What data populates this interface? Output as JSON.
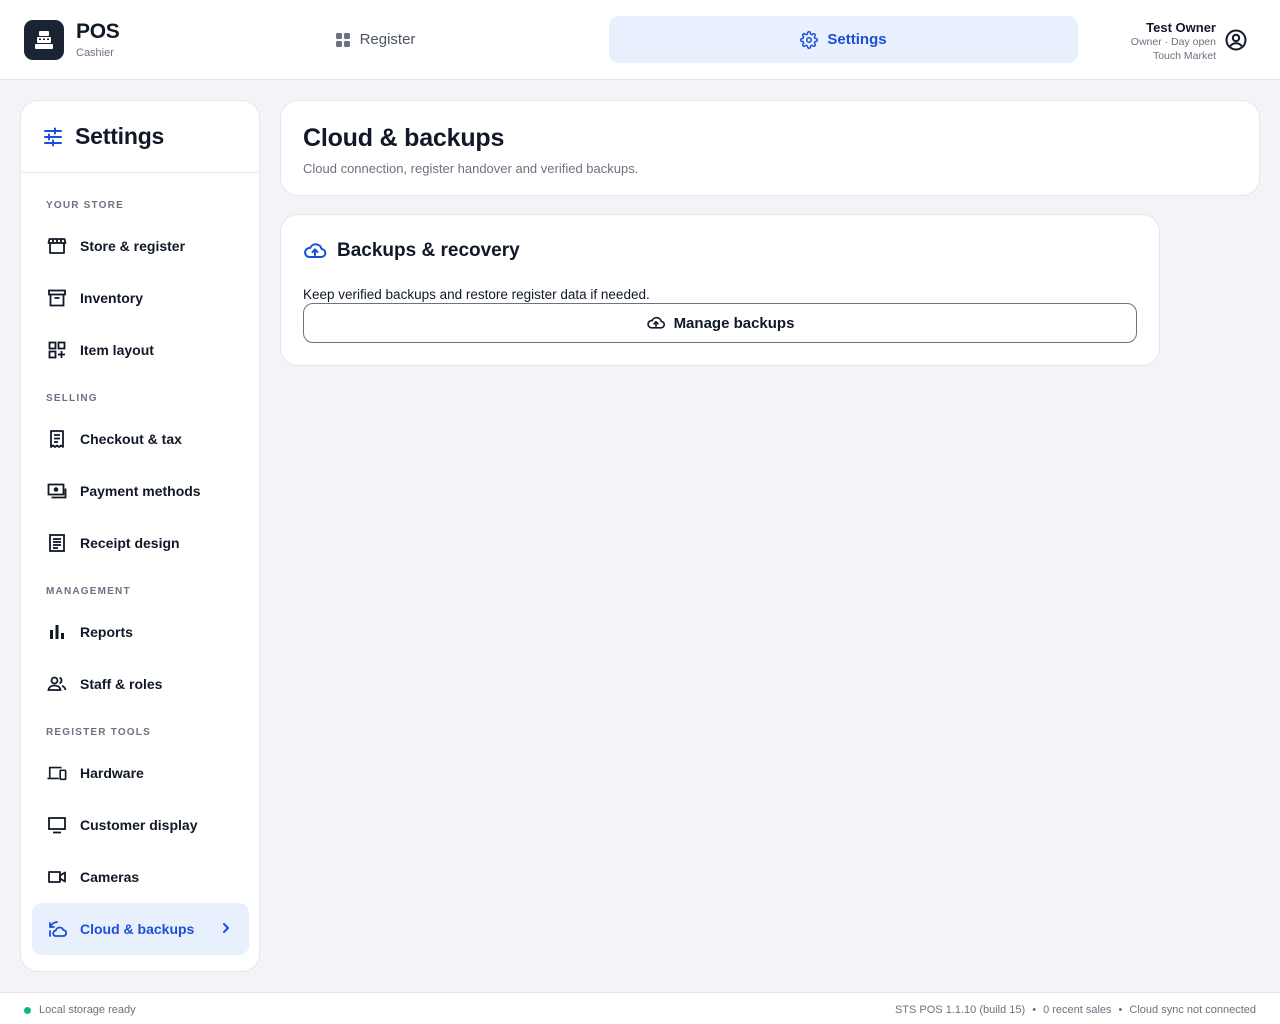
{
  "app": {
    "title": "POS",
    "subtitle": "Cashier"
  },
  "nav": {
    "register_label": "Register",
    "settings_label": "Settings",
    "active": "settings"
  },
  "user": {
    "name": "Test Owner",
    "role_status": "Owner · Day open",
    "store": "Touch Market"
  },
  "sidebar": {
    "title": "Settings",
    "sections": [
      {
        "label": "YOUR STORE"
      },
      {
        "label": "SELLING"
      },
      {
        "label": "MANAGEMENT"
      },
      {
        "label": "REGISTER TOOLS"
      }
    ],
    "items": [
      {
        "label": "Store & register",
        "icon": "storefront-icon"
      },
      {
        "label": "Inventory",
        "icon": "inventory-box-icon"
      },
      {
        "label": "Item layout",
        "icon": "grid-add-icon"
      },
      {
        "label": "Checkout & tax",
        "icon": "receipt-tax-icon"
      },
      {
        "label": "Payment methods",
        "icon": "payments-icon"
      },
      {
        "label": "Receipt design",
        "icon": "receipt-long-icon"
      },
      {
        "label": "Reports",
        "icon": "bar-chart-icon"
      },
      {
        "label": "Staff & roles",
        "icon": "people-icon"
      },
      {
        "label": "Hardware",
        "icon": "devices-icon"
      },
      {
        "label": "Customer display",
        "icon": "monitor-icon"
      },
      {
        "label": "Cameras",
        "icon": "videocam-icon"
      },
      {
        "label": "Cloud & backups",
        "icon": "cloud-sync-icon",
        "active": true
      }
    ]
  },
  "page": {
    "title": "Cloud & backups",
    "subtitle": "Cloud connection, register handover and verified backups."
  },
  "backups_card": {
    "title": "Backups & recovery",
    "description": "Keep verified backups and restore register data if needed.",
    "button_label": "Manage backups"
  },
  "status": {
    "storage": "Local storage ready",
    "version": "STS POS 1.1.10 (build 15)",
    "recent_sales": "0 recent sales",
    "cloud": "Cloud sync not connected",
    "separator": "•"
  },
  "colors": {
    "accent": "#1d4ed8",
    "accent_bg": "#e9f0fd",
    "status_ok": "#10b981",
    "brand_logo_bg": "#1b2433"
  }
}
